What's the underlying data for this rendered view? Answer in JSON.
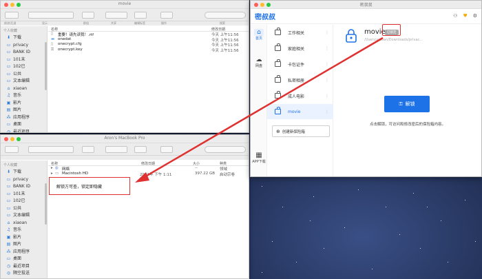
{
  "top_finder": {
    "title": "movie",
    "toolbar_labels": [
      "前进/后退",
      "显示",
      "群组",
      "共享",
      "编辑标签",
      "操作",
      "搜索"
    ],
    "sidebar_section": "个人收藏",
    "sidebar": [
      {
        "icon": "download-icon",
        "glyph": "⬇",
        "label": "下载"
      },
      {
        "icon": "folder-icon",
        "glyph": "▭",
        "label": "privacy"
      },
      {
        "icon": "folder-icon",
        "glyph": "▭",
        "label": "BANK ID"
      },
      {
        "icon": "folder-icon",
        "glyph": "▭",
        "label": "101末"
      },
      {
        "icon": "folder-icon",
        "glyph": "▭",
        "label": "102已"
      },
      {
        "icon": "folder-icon",
        "glyph": "▭",
        "label": "公共"
      },
      {
        "icon": "folder-icon",
        "glyph": "▭",
        "label": "文本编辑"
      },
      {
        "icon": "home-icon",
        "glyph": "⌂",
        "label": "xiaoan"
      },
      {
        "icon": "music-icon",
        "glyph": "♫",
        "label": "音乐"
      },
      {
        "icon": "movie-icon",
        "glyph": "▣",
        "label": "影片"
      },
      {
        "icon": "picture-icon",
        "glyph": "▤",
        "label": "图片"
      },
      {
        "icon": "apps-icon",
        "glyph": "⁂",
        "label": "应用程序"
      },
      {
        "icon": "desktop-icon",
        "glyph": "▭",
        "label": "桌面"
      },
      {
        "icon": "recents-icon",
        "glyph": "◷",
        "label": "最近项目"
      }
    ],
    "columns": {
      "name": "名称",
      "date": "修改日期"
    },
    "files": [
      {
        "icon": "document-icon",
        "name": "重要！请先读我！.rtf",
        "date": "今天 上午11:56"
      },
      {
        "icon": "folder-icon",
        "name": "onedat",
        "date": "今天 上午11:56"
      },
      {
        "icon": "document-icon",
        "name": "onecrypt.cfg",
        "date": "今天 上午11:56"
      },
      {
        "icon": "key-file-icon",
        "name": "onecrypt.key",
        "date": "今天 上午11:56"
      }
    ]
  },
  "bottom_finder": {
    "title": "Aron's MacBook Pro",
    "sidebar_section": "个人收藏",
    "sidebar": [
      {
        "icon": "download-icon",
        "glyph": "⬇",
        "label": "下载"
      },
      {
        "icon": "folder-icon",
        "glyph": "▭",
        "label": "privacy"
      },
      {
        "icon": "folder-icon",
        "glyph": "▭",
        "label": "BANK ID"
      },
      {
        "icon": "folder-icon",
        "glyph": "▭",
        "label": "101末"
      },
      {
        "icon": "folder-icon",
        "glyph": "▭",
        "label": "102已"
      },
      {
        "icon": "folder-icon",
        "glyph": "▭",
        "label": "公共"
      },
      {
        "icon": "folder-icon",
        "glyph": "▭",
        "label": "文本编辑"
      },
      {
        "icon": "home-icon",
        "glyph": "⌂",
        "label": "xiaoan"
      },
      {
        "icon": "music-icon",
        "glyph": "♫",
        "label": "音乐"
      },
      {
        "icon": "movie-icon",
        "glyph": "▣",
        "label": "影片"
      },
      {
        "icon": "picture-icon",
        "glyph": "▤",
        "label": "图片"
      },
      {
        "icon": "apps-icon",
        "glyph": "⁂",
        "label": "应用程序"
      },
      {
        "icon": "desktop-icon",
        "glyph": "▭",
        "label": "桌面"
      },
      {
        "icon": "recents-icon",
        "glyph": "◷",
        "label": "最近项目"
      },
      {
        "icon": "airdrop-icon",
        "glyph": "◎",
        "label": "隔空投送"
      }
    ],
    "columns": {
      "name": "名称",
      "date": "修改日期",
      "size": "大小",
      "kind": "种类"
    },
    "files": [
      {
        "icon": "network-icon",
        "name": "网络",
        "date": "",
        "size": "--",
        "kind": "领域"
      },
      {
        "icon": "drive-icon",
        "name": "Macintosh HD",
        "date": "2021年 下午 1:11",
        "size": "397.22 GB",
        "kind": "启动宗卷"
      }
    ]
  },
  "app": {
    "window_title": "密叔叔",
    "brand": "密叔叔",
    "rail": [
      {
        "icon": "home-icon",
        "label": "首页"
      },
      {
        "icon": "cloud-icon",
        "label": "网盘"
      }
    ],
    "app_download": "APP下载",
    "vaults": [
      "工作相关",
      "家庭相关",
      "卡包证件",
      "私密相册",
      "成人电影",
      "movie"
    ],
    "create_vault": "创建新保险箱",
    "detail": {
      "name": "movie",
      "badge": "已锁定",
      "path": "/Users/xiaoan/Downloads/privac...",
      "unlock_button": "解锁",
      "hint": "点击解锁，可访问和修改密后的保险箱内容。"
    }
  },
  "annotation": "解锁方可查，锁定即隐藏",
  "colors": {
    "accent": "#1d72e8",
    "annotation_red": "#e03131"
  }
}
